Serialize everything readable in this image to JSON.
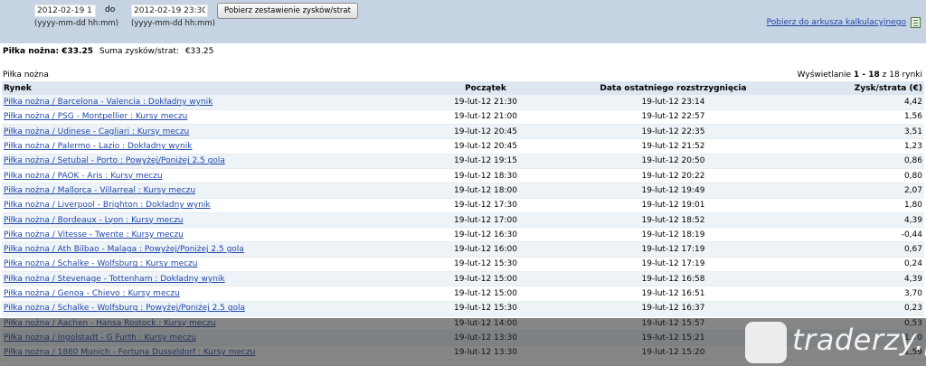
{
  "filter": {
    "from_value": "2012-02-19 11:00",
    "to_label": "do",
    "to_value": "2012-02-19 23:30",
    "format_hint": "(yyyy-mm-dd hh:mm)",
    "fetch_button": "Pobierz zestawienie zysków/strat",
    "sheet_link": "Pobierz do arkusza kalkulacyjnego"
  },
  "summary": {
    "sport_total": "Piłka nożna: €33.25",
    "sum_label": "Suma zysków/strat:",
    "sum_value": "€33.25"
  },
  "section_title": "Piłka nożna",
  "paging": {
    "prefix": "Wyświetlanie",
    "range": "1 - 18",
    "suffix": "z 18 rynki"
  },
  "table": {
    "headers": [
      "Rynek",
      "Początek",
      "Data ostatniego rozstrzygnięcia",
      "Zysk/strata (€)"
    ],
    "rows": [
      {
        "market": "Piłka nożna / Barcelona - Valencia : Dokładny wynik",
        "start": "19-lut-12 21:30",
        "settled": "19-lut-12 23:14",
        "pl": "4,42"
      },
      {
        "market": "Piłka nożna / PSG - Montpellier : Kursy meczu",
        "start": "19-lut-12 21:00",
        "settled": "19-lut-12 22:57",
        "pl": "1,56"
      },
      {
        "market": "Piłka nożna / Udinese - Cagliari : Kursy meczu",
        "start": "19-lut-12 20:45",
        "settled": "19-lut-12 22:35",
        "pl": "3,51"
      },
      {
        "market": "Piłka nożna / Palermo - Lazio : Dokładny wynik",
        "start": "19-lut-12 20:45",
        "settled": "19-lut-12 21:52",
        "pl": "1,23"
      },
      {
        "market": "Piłka nożna / Setubal - Porto : Powyżej/Poniżej 2.5 gola",
        "start": "19-lut-12 19:15",
        "settled": "19-lut-12 20:50",
        "pl": "0,86"
      },
      {
        "market": "Piłka nożna / PAOK - Aris : Kursy meczu",
        "start": "19-lut-12 18:30",
        "settled": "19-lut-12 20:22",
        "pl": "0,80"
      },
      {
        "market": "Piłka nożna / Mallorca - Villarreal : Kursy meczu",
        "start": "19-lut-12 18:00",
        "settled": "19-lut-12 19:49",
        "pl": "2,07"
      },
      {
        "market": "Piłka nożna / Liverpool - Brighton : Dokładny wynik",
        "start": "19-lut-12 17:30",
        "settled": "19-lut-12 19:01",
        "pl": "1,80"
      },
      {
        "market": "Piłka nożna / Bordeaux - Lyon : Kursy meczu",
        "start": "19-lut-12 17:00",
        "settled": "19-lut-12 18:52",
        "pl": "4,39"
      },
      {
        "market": "Piłka nożna / Vitesse - Twente : Kursy meczu",
        "start": "19-lut-12 16:30",
        "settled": "19-lut-12 18:19",
        "pl": "-0,44"
      },
      {
        "market": "Piłka nożna / Ath Bilbao - Malaga : Powyżej/Poniżej 2.5 gola",
        "start": "19-lut-12 16:00",
        "settled": "19-lut-12 17:19",
        "pl": "0,67"
      },
      {
        "market": "Piłka nożna / Schalke - Wolfsburg : Kursy meczu",
        "start": "19-lut-12 15:30",
        "settled": "19-lut-12 17:19",
        "pl": "0,24"
      },
      {
        "market": "Piłka nożna / Stevenage - Tottenham : Dokładny wynik",
        "start": "19-lut-12 15:00",
        "settled": "19-lut-12 16:58",
        "pl": "4,39"
      },
      {
        "market": "Piłka nożna / Genoa - Chievo : Kursy meczu",
        "start": "19-lut-12 15:00",
        "settled": "19-lut-12 16:51",
        "pl": "3,70"
      },
      {
        "market": "Piłka nożna / Schalke - Wolfsburg : Powyżej/Poniżej 2.5 gola",
        "start": "19-lut-12 15:30",
        "settled": "19-lut-12 16:37",
        "pl": "0,23"
      },
      {
        "market": "Piłka nożna / Aachen - Hansa Rostock : Kursy meczu",
        "start": "19-lut-12 14:00",
        "settled": "19-lut-12 15:57",
        "pl": "0,53"
      },
      {
        "market": "Piłka nożna / Ingolstadt - G Furth : Kursy meczu",
        "start": "19-lut-12 13:30",
        "settled": "19-lut-12 15:21",
        "pl": "1,70"
      },
      {
        "market": "Piłka nożna / 1860 Munich - Fortuna Dusseldorf : Kursy meczu",
        "start": "19-lut-12 13:30",
        "settled": "19-lut-12 15:20",
        "pl": "1,59"
      }
    ]
  },
  "watermark": {
    "text": "traderzy.pl"
  }
}
